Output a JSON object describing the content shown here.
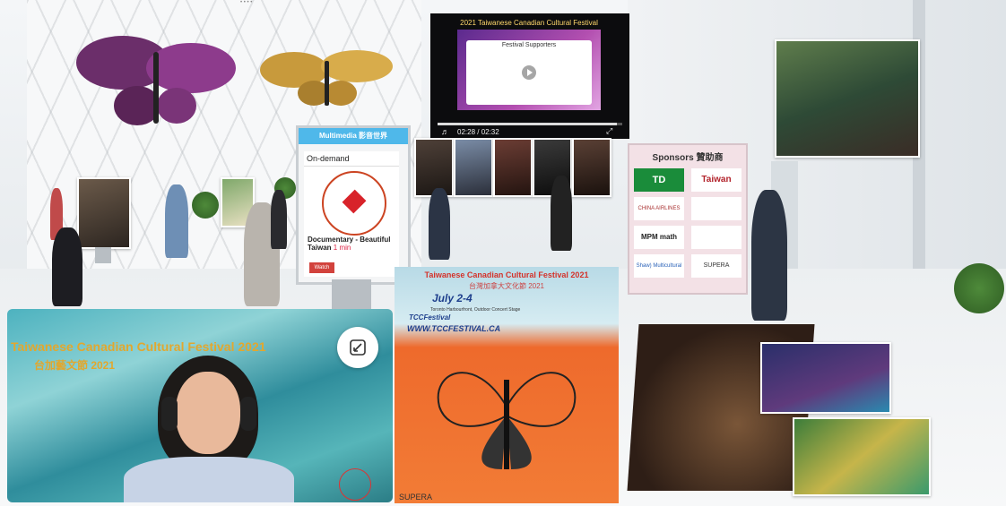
{
  "video": {
    "slide_title": "2021 Taiwanese Canadian Cultural Festival",
    "slide_subtitle": "Festival Supporters",
    "time": "02:28 / 02:32",
    "progress": 0.97
  },
  "kiosk": {
    "header": "Multimedia 影音世界",
    "tab": "On-demand",
    "item_title": "Documentary - Beautiful Taiwan",
    "item_duration": "1 min",
    "button_label": "Watch"
  },
  "sponsors": {
    "title": "Sponsors 贊助商",
    "logos": [
      "TD",
      "Taiwan",
      "CHINA AIRLINES",
      "",
      "MPM math",
      "",
      "Shaw) Multicultural",
      "SUPERA"
    ]
  },
  "banner": {
    "title_en": "Taiwanese Canadian Cultural Festival 2021",
    "title_zh": "台灣加拿大文化節 2021",
    "dates": "July 2-4",
    "location": "Toronto Harbourfront, Outdoor Concert Stage",
    "social": "TCCFestival",
    "website": "WWW.TCCFESTIVAL.CA",
    "bottom_sponsor": "SUPERA"
  },
  "webcam": {
    "title_en": "Taiwanese Canadian Cultural Festival 2021",
    "title_zh": "台加藝文節 2021"
  },
  "icons": [
    "play-icon",
    "volume-icon",
    "fullscreen-icon",
    "expand-icon",
    "canada-leaf-logo-icon"
  ]
}
